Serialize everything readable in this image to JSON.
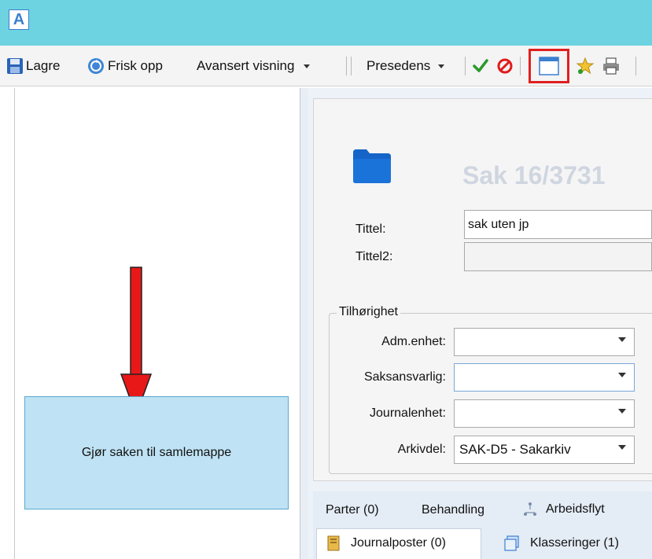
{
  "app": {
    "logo_letter": "A",
    "titlebar_color": "#6dd3e0"
  },
  "toolbar": {
    "save_label": "Lagre",
    "refresh_label": "Frisk opp",
    "view_dropdown": "Avansert visning",
    "precedent_label": "Presedens",
    "icons": [
      "save-icon",
      "refresh-icon",
      "approve-check-icon",
      "cancel-icon",
      "folder-window-icon",
      "favorite-star-icon",
      "print-icon"
    ],
    "highlight_color": "#e02020"
  },
  "annotation": {
    "callout_text": "Gjør saken til samlemappe",
    "arrow_color": "#e81818"
  },
  "case": {
    "title": "Sak 16/3731",
    "tittel_label": "Tittel:",
    "tittel_value": "sak uten jp",
    "tittel2_label": "Tittel2:",
    "tittel2_value": ""
  },
  "belonging": {
    "group_title": "Tilhørighet",
    "fields": [
      {
        "label": "Adm.enhet:",
        "value": ""
      },
      {
        "label": "Saksansvarlig:",
        "value": ""
      },
      {
        "label": "Journalenhet:",
        "value": ""
      },
      {
        "label": "Arkivdel:",
        "value": "SAK-D5 - Sakarkiv"
      }
    ]
  },
  "tabs": {
    "row1": [
      "Parter (0)",
      "Behandling",
      "Arbeidsflyt"
    ],
    "row2": [
      "Journalposter (0)",
      "Klasseringer (1)"
    ]
  }
}
